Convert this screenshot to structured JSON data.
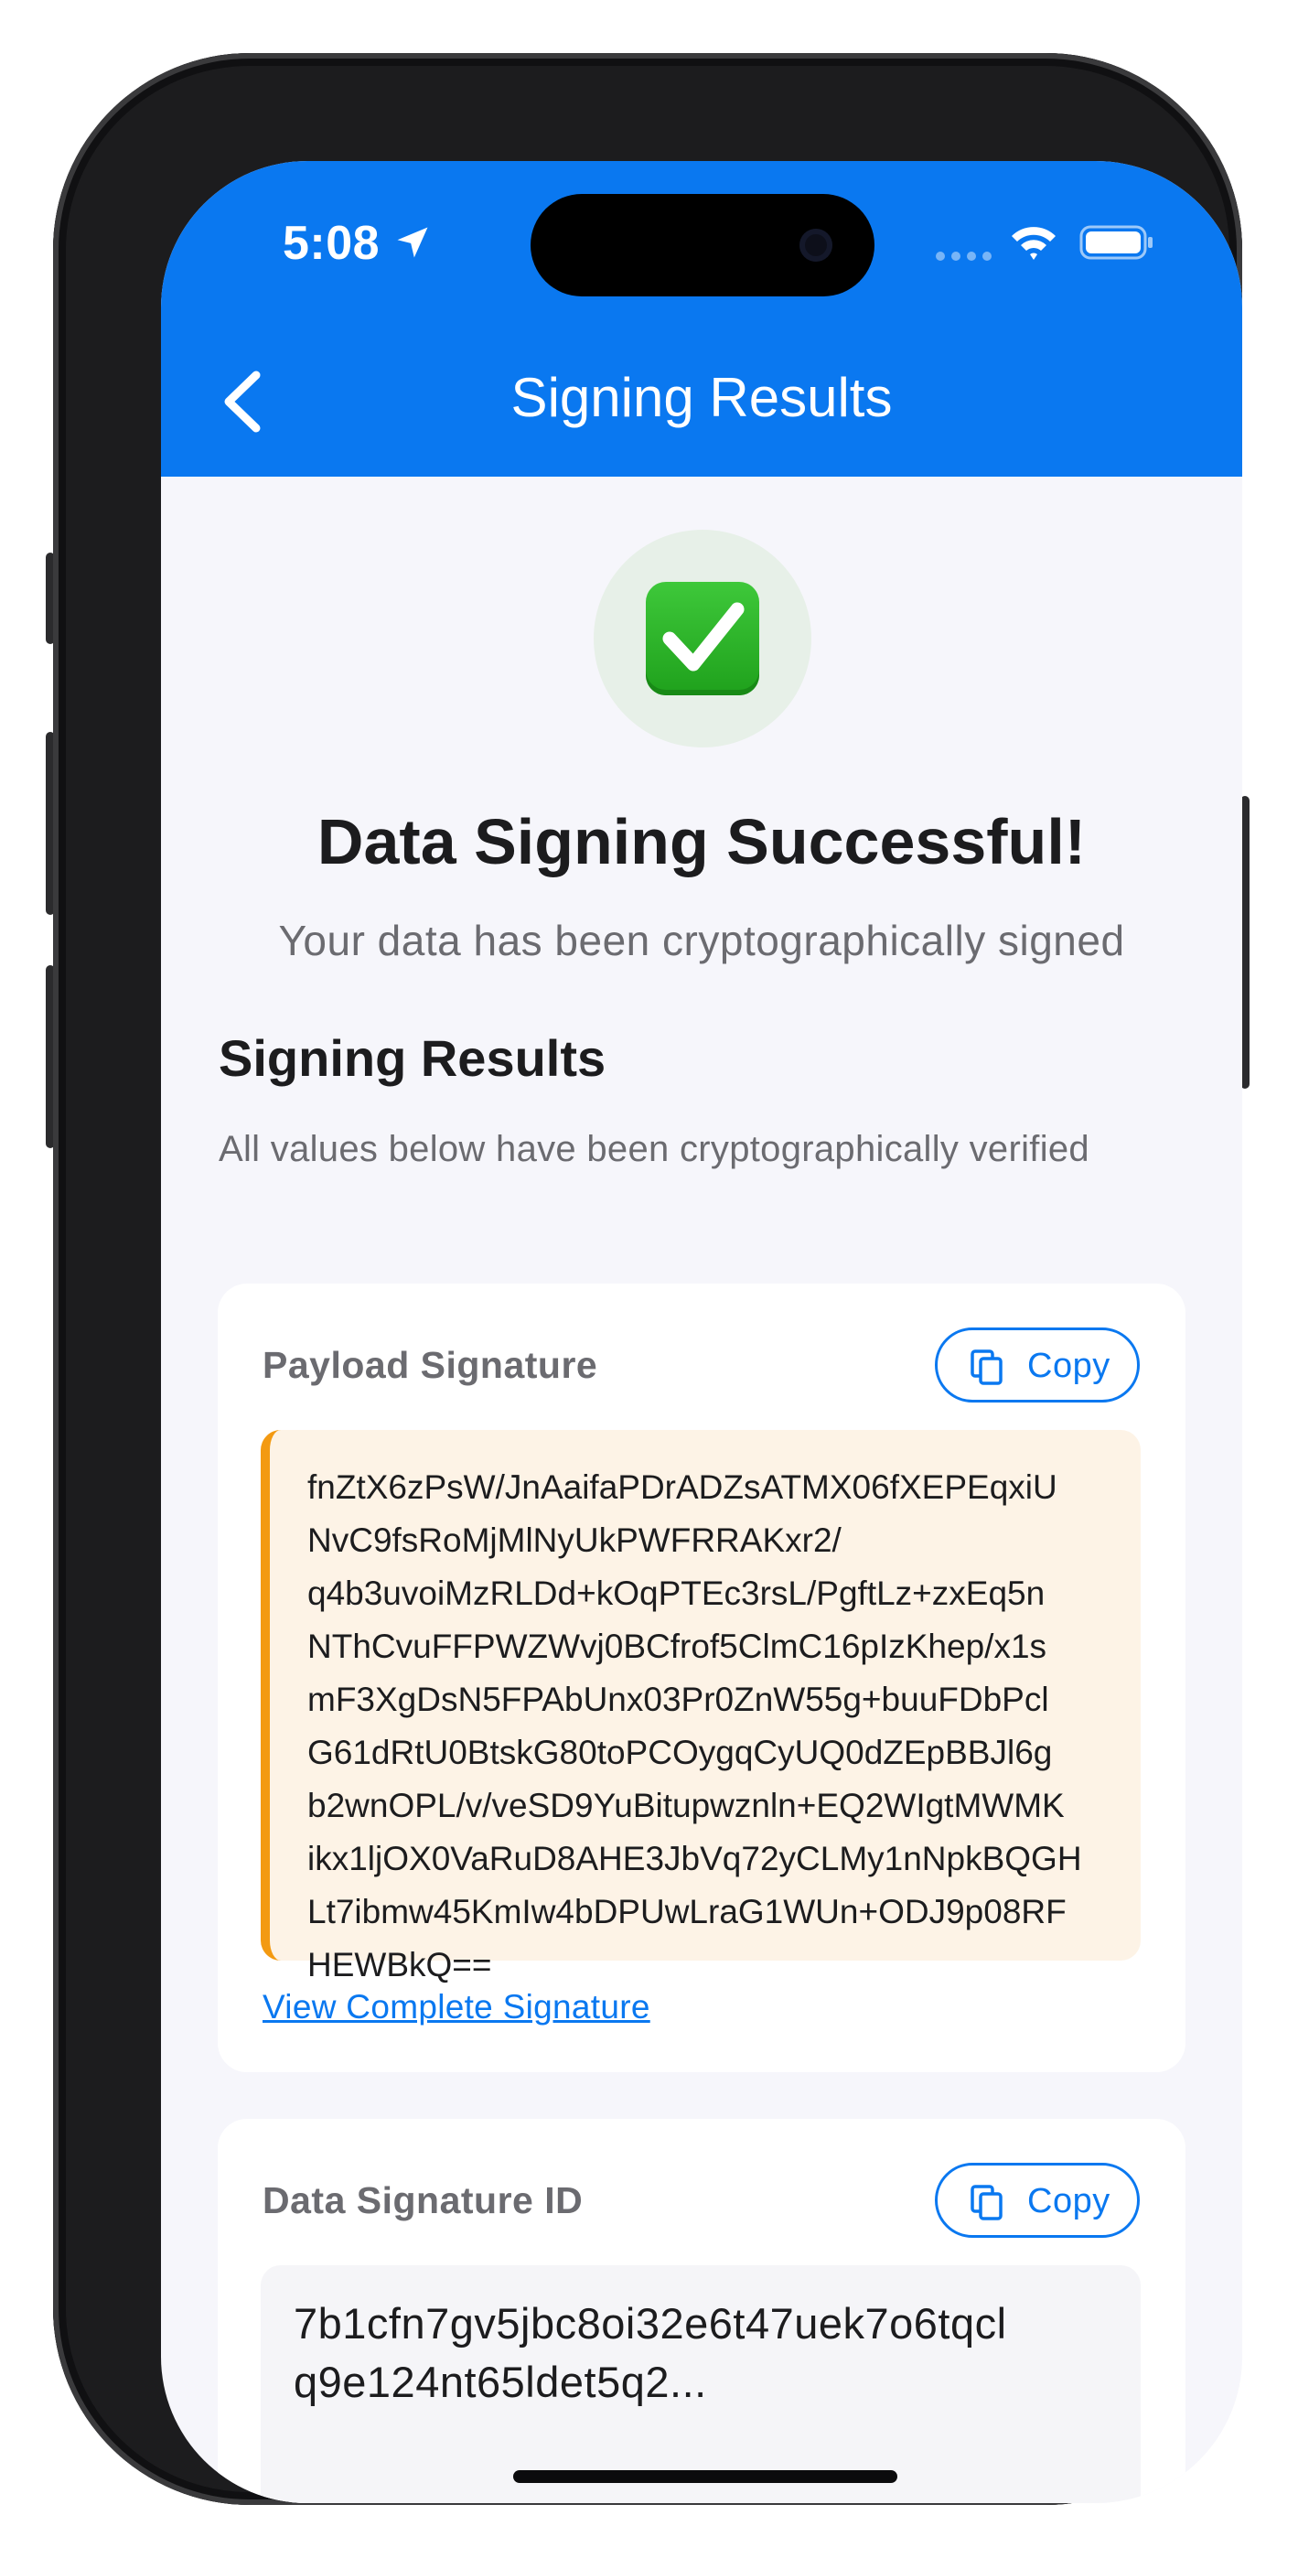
{
  "status_bar": {
    "time": "5:08"
  },
  "nav": {
    "title": "Signing Results"
  },
  "hero": {
    "icon": "check-mark-button-icon",
    "title": "Data Signing Successful!",
    "subtitle": "Your data has been cryptographically signed"
  },
  "section": {
    "title": "Signing Results",
    "subtitle": "All values below have been cryptographically verified"
  },
  "payload_card": {
    "label": "Payload Signature",
    "copy_label": "Copy",
    "signature": "fnZtX6zPsW/JnAaifaPDrADZsATMX06fXEPEqxiU\nNvC9fsRoMjMlNyUkPWFRRAKxr2/\nq4b3uvoiMzRLDd+kOqPTEc3rsL/PgftLz+zxEq5n\nNThCvuFFPWZWvj0BCfrof5ClmC16pIzKhep/x1s\nmF3XgDsN5FPAbUnx03Pr0ZnW55g+buuFDbPcl\nG61dRtU0BtskG80toPCOygqCyUQ0dZEpBBJl6g\nb2wnOPL/v/veSD9YuBitupwznln+EQ2WIgtMWMK\nikx1ljOX0VaRuD8AHE3JbVq72yCLMy1nNpkBQGH\nLt7ibmw45KmIw4bDPUwLraG1WUn+ODJ9p08RF\nHEWBkQ==",
    "view_link": "View Complete Signature",
    "accent_color": "#f39a12"
  },
  "id_card": {
    "label": "Data Signature ID",
    "copy_label": "Copy",
    "value": "7b1cfn7gv5jbc8oi32e6t47uek7o6tqcl\nq9e124nt65ldet5q2..."
  },
  "colors": {
    "brand_blue": "#0a78f0",
    "background": "#f6f6fb",
    "success_green": "#1fa11c"
  }
}
